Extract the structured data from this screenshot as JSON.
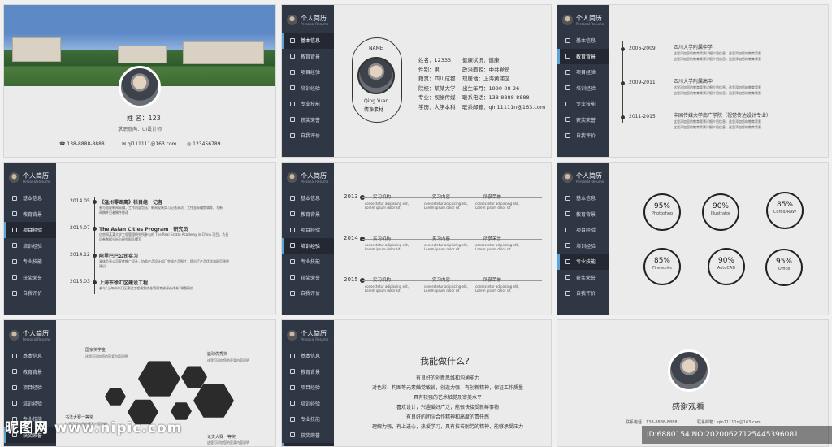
{
  "brand": {
    "title": "个人简历",
    "subtitle": "Personal Resume"
  },
  "nav": [
    "基本信息",
    "教育背景",
    "项目经验",
    "培训经验",
    "专业技能",
    "获奖荣誉",
    "自我评价"
  ],
  "slide1": {
    "name": "姓 名：123",
    "job": "求职意向：UI设计师",
    "phone": "138-8888-8888",
    "email": "qi111111@163.com",
    "qq": "123456789"
  },
  "slide2": {
    "name_label": "NAME",
    "name_en": "Qing Yuan",
    "name_cn": "情净素材",
    "fields": [
      [
        "姓名：12333",
        "健康状况：健康"
      ],
      [
        "性别：男",
        "政治面貌：中共党员"
      ],
      [
        "籍贯：四川成都",
        "现居地：上海黄浦区"
      ],
      [
        "院校：某某大学",
        "出生年月：1990-08-26"
      ],
      [
        "专业：视觉传媒",
        "联系电话：138-8888-8888"
      ],
      [
        "学历：大学本科",
        "联系邮箱：qin11111n@163.com"
      ]
    ]
  },
  "slide3": {
    "items": [
      {
        "years": "2006-2009",
        "school": "四川大学附属中学",
        "desc1": "这里添加您的教育背景详细介绍信息，这里添加您的教育背景",
        "desc2": "这里添加您的教育背景详细介绍信息，这里添加您的教育背景"
      },
      {
        "years": "2009-2011",
        "school": "四川大学附属高中",
        "desc1": "这里添加您的教育背景详细介绍信息，这里添加您的教育背景",
        "desc2": "这里添加您的教育背景详细介绍信息，这里添加您的教育背景"
      },
      {
        "years": "2011-2015",
        "school": "中国传媒大学南广学院（视觉传达设计专业）",
        "desc1": "这里添加您的教育背景详细介绍信息，这里添加您的教育背景",
        "desc2": "这里添加您的教育背景详细介绍信息，这里添加您的教育背景"
      }
    ]
  },
  "slide4": {
    "items": [
      {
        "date": "2014.05",
        "title": "《温州零距离》栏目组　记者",
        "desc1": "参与电视新闻采编，工作内容包括：新闻现场实习记者采访、工作室采编剪辑等，写新",
        "desc2": "闻稿并记者稿件修改"
      },
      {
        "date": "2014.07",
        "title": "The Asian Cities Program　研究员",
        "desc1": "亿房网某某大学工程管理研究所参与的 The Real Estate Academy in China 项目，负责",
        "desc2": "问卷数据分析与研究报告撰写"
      },
      {
        "date": "2014.12",
        "title": "阿里巴巴公司实习",
        "desc1": "具体负责公司宣传推广设计，协助产品设计部门完成产品图片，提出了产品优化和网页改进",
        "desc2": "建议"
      },
      {
        "date": "2015.03",
        "title": "上海市徐汇区建设工程",
        "desc1": "参与“上海市徐汇区建设工程规划综合管理考核评价体系”课题研究",
        "desc2": ""
      }
    ]
  },
  "slide5": {
    "years": [
      "2013",
      "2014",
      "2015"
    ],
    "col_titles": [
      "实习机构",
      "实习内容",
      "所获荣誉"
    ],
    "lorem1": "consectetur adipiscing elit,",
    "lorem2": "Lorem ipsum dolor sit"
  },
  "slide6": {
    "skills": [
      {
        "pct": "95%",
        "name": "Photoshop"
      },
      {
        "pct": "90%",
        "name": "Illustrator"
      },
      {
        "pct": "85%",
        "name": "CorelDRAW"
      },
      {
        "pct": "85%",
        "name": "Fireworks"
      },
      {
        "pct": "90%",
        "name": "AutoCAD"
      },
      {
        "pct": "95%",
        "name": "Office"
      }
    ]
  },
  "slide7": {
    "labels": [
      {
        "title": "国家奖学金",
        "desc": "这里可添加您的获奖内容说明"
      },
      {
        "title": "篮球优秀奖",
        "desc": "这里可添加您的获奖内容说明"
      },
      {
        "title": "书法大赛一等奖",
        "desc": "这里可添加您的获奖内容说明"
      },
      {
        "title": "论文大赛一等奖",
        "desc": "这里可添加您的获奖内容说明"
      }
    ]
  },
  "slide8": {
    "title": "我能做什么?",
    "lines": [
      "有良好的创新思维和沟通能力",
      "对色彩、构图等元素触觉敏锐，创造力强；有创新精神，保证工作质量",
      "具有较强的艺术触觉及审美水平",
      "喜欢设计，兴趣爱好广泛，能很快接受新鲜事物",
      "有良好的团队合作精神和高度的责任感",
      "理解力强，有上进心，热爱学习，具有拉苦耐劳的精神，能够承受压力"
    ]
  },
  "slide9": {
    "thanks": "感谢观看",
    "phone": "联系电话：138-8888-8888",
    "email": "联系邮箱：qin11111n@163.com"
  },
  "watermark": {
    "text": "昵图网 www.nipic.com"
  },
  "id_tag": {
    "text": "ID:6880154 NO:20200627125445396081"
  }
}
